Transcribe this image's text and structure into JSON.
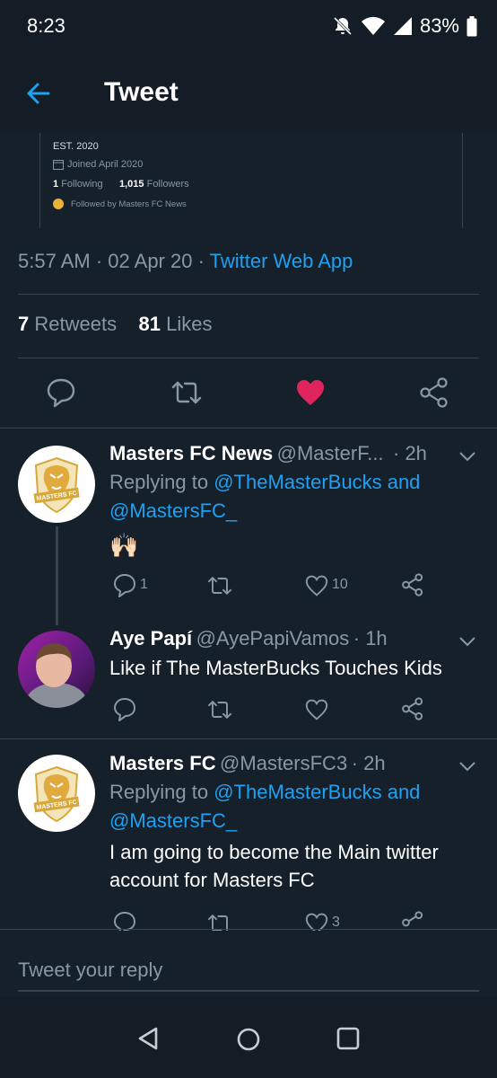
{
  "status_bar": {
    "time": "8:23",
    "battery": "83%"
  },
  "header": {
    "title": "Tweet"
  },
  "embedded_profile": {
    "est": "EST. 2020",
    "joined": "Joined April 2020",
    "following_count": "1",
    "following_label": "Following",
    "followers_count": "1,015",
    "followers_label": "Followers",
    "followed_by": "Followed by Masters FC News"
  },
  "tweet_meta": {
    "time": "5:57 AM",
    "date": "02 Apr 20",
    "source": "Twitter Web App",
    "separator": " · "
  },
  "stats": {
    "retweets_count": "7",
    "retweets_label": "Retweets",
    "likes_count": "81",
    "likes_label": "Likes"
  },
  "replies": [
    {
      "name": "Masters FC News",
      "handle": "@MasterF...",
      "time": "· 2h",
      "replying_prefix": "Replying to",
      "replying_to_1": "@TheMasterBucks and",
      "replying_to_2": "@MastersFC_",
      "text": "🙌🏻",
      "reply_count": "1",
      "like_count": "10"
    },
    {
      "name": "Aye Papí",
      "handle": "@AyePapiVamos",
      "time": "· 1h",
      "text": "Like if The MasterBucks Touches Kids"
    },
    {
      "name": "Masters FC",
      "handle": "@MastersFC3",
      "time": "· 2h",
      "replying_prefix": "Replying to",
      "replying_to_1": "@TheMasterBucks and",
      "replying_to_2": "@MastersFC_",
      "text_line1": "I am going to become the Main twitter",
      "text_line2": "account for Masters FC",
      "like_count": "3"
    }
  ],
  "logo_text": "MASTERS FC",
  "compose": {
    "placeholder": "Tweet your reply"
  },
  "colors": {
    "background": "#15202b",
    "accent": "#1da1f2",
    "like": "#e0245e",
    "muted": "#8899a6",
    "divider": "#38444d"
  }
}
